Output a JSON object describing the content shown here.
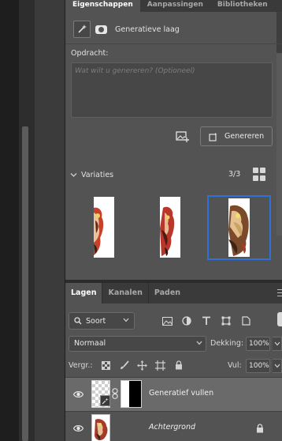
{
  "properties": {
    "tabs": [
      "Eigenschappen",
      "Aanpassingen",
      "Bibliotheken"
    ],
    "layer_type": "Generatieve laag",
    "prompt_label": "Opdracht:",
    "prompt_placeholder": "Wat wilt u genereren? (Optioneel)",
    "prompt_value": "",
    "generate_button": "Genereren",
    "variations_title": "Variaties",
    "variations_count": "3/3",
    "selected_variation": 3
  },
  "layers_panel": {
    "tabs": [
      "Lagen",
      "Kanalen",
      "Paden"
    ],
    "filter_kind": "Soort",
    "blend_mode": "Normaal",
    "opacity_label": "Dekking:",
    "opacity_value": "100%",
    "lock_label": "Vergr.:",
    "fill_label": "Vul:",
    "fill_value": "100%",
    "layers": [
      {
        "name": "Generatief vullen",
        "visible": true,
        "selected": true
      },
      {
        "name": "Achtergrond",
        "visible": true,
        "locked": true
      }
    ]
  },
  "colors": {
    "panel_bg": "#535353",
    "tab_bar": "#3a3a3a",
    "selection_border": "#2f6fd8",
    "active_layer": "#6a6a6a"
  }
}
